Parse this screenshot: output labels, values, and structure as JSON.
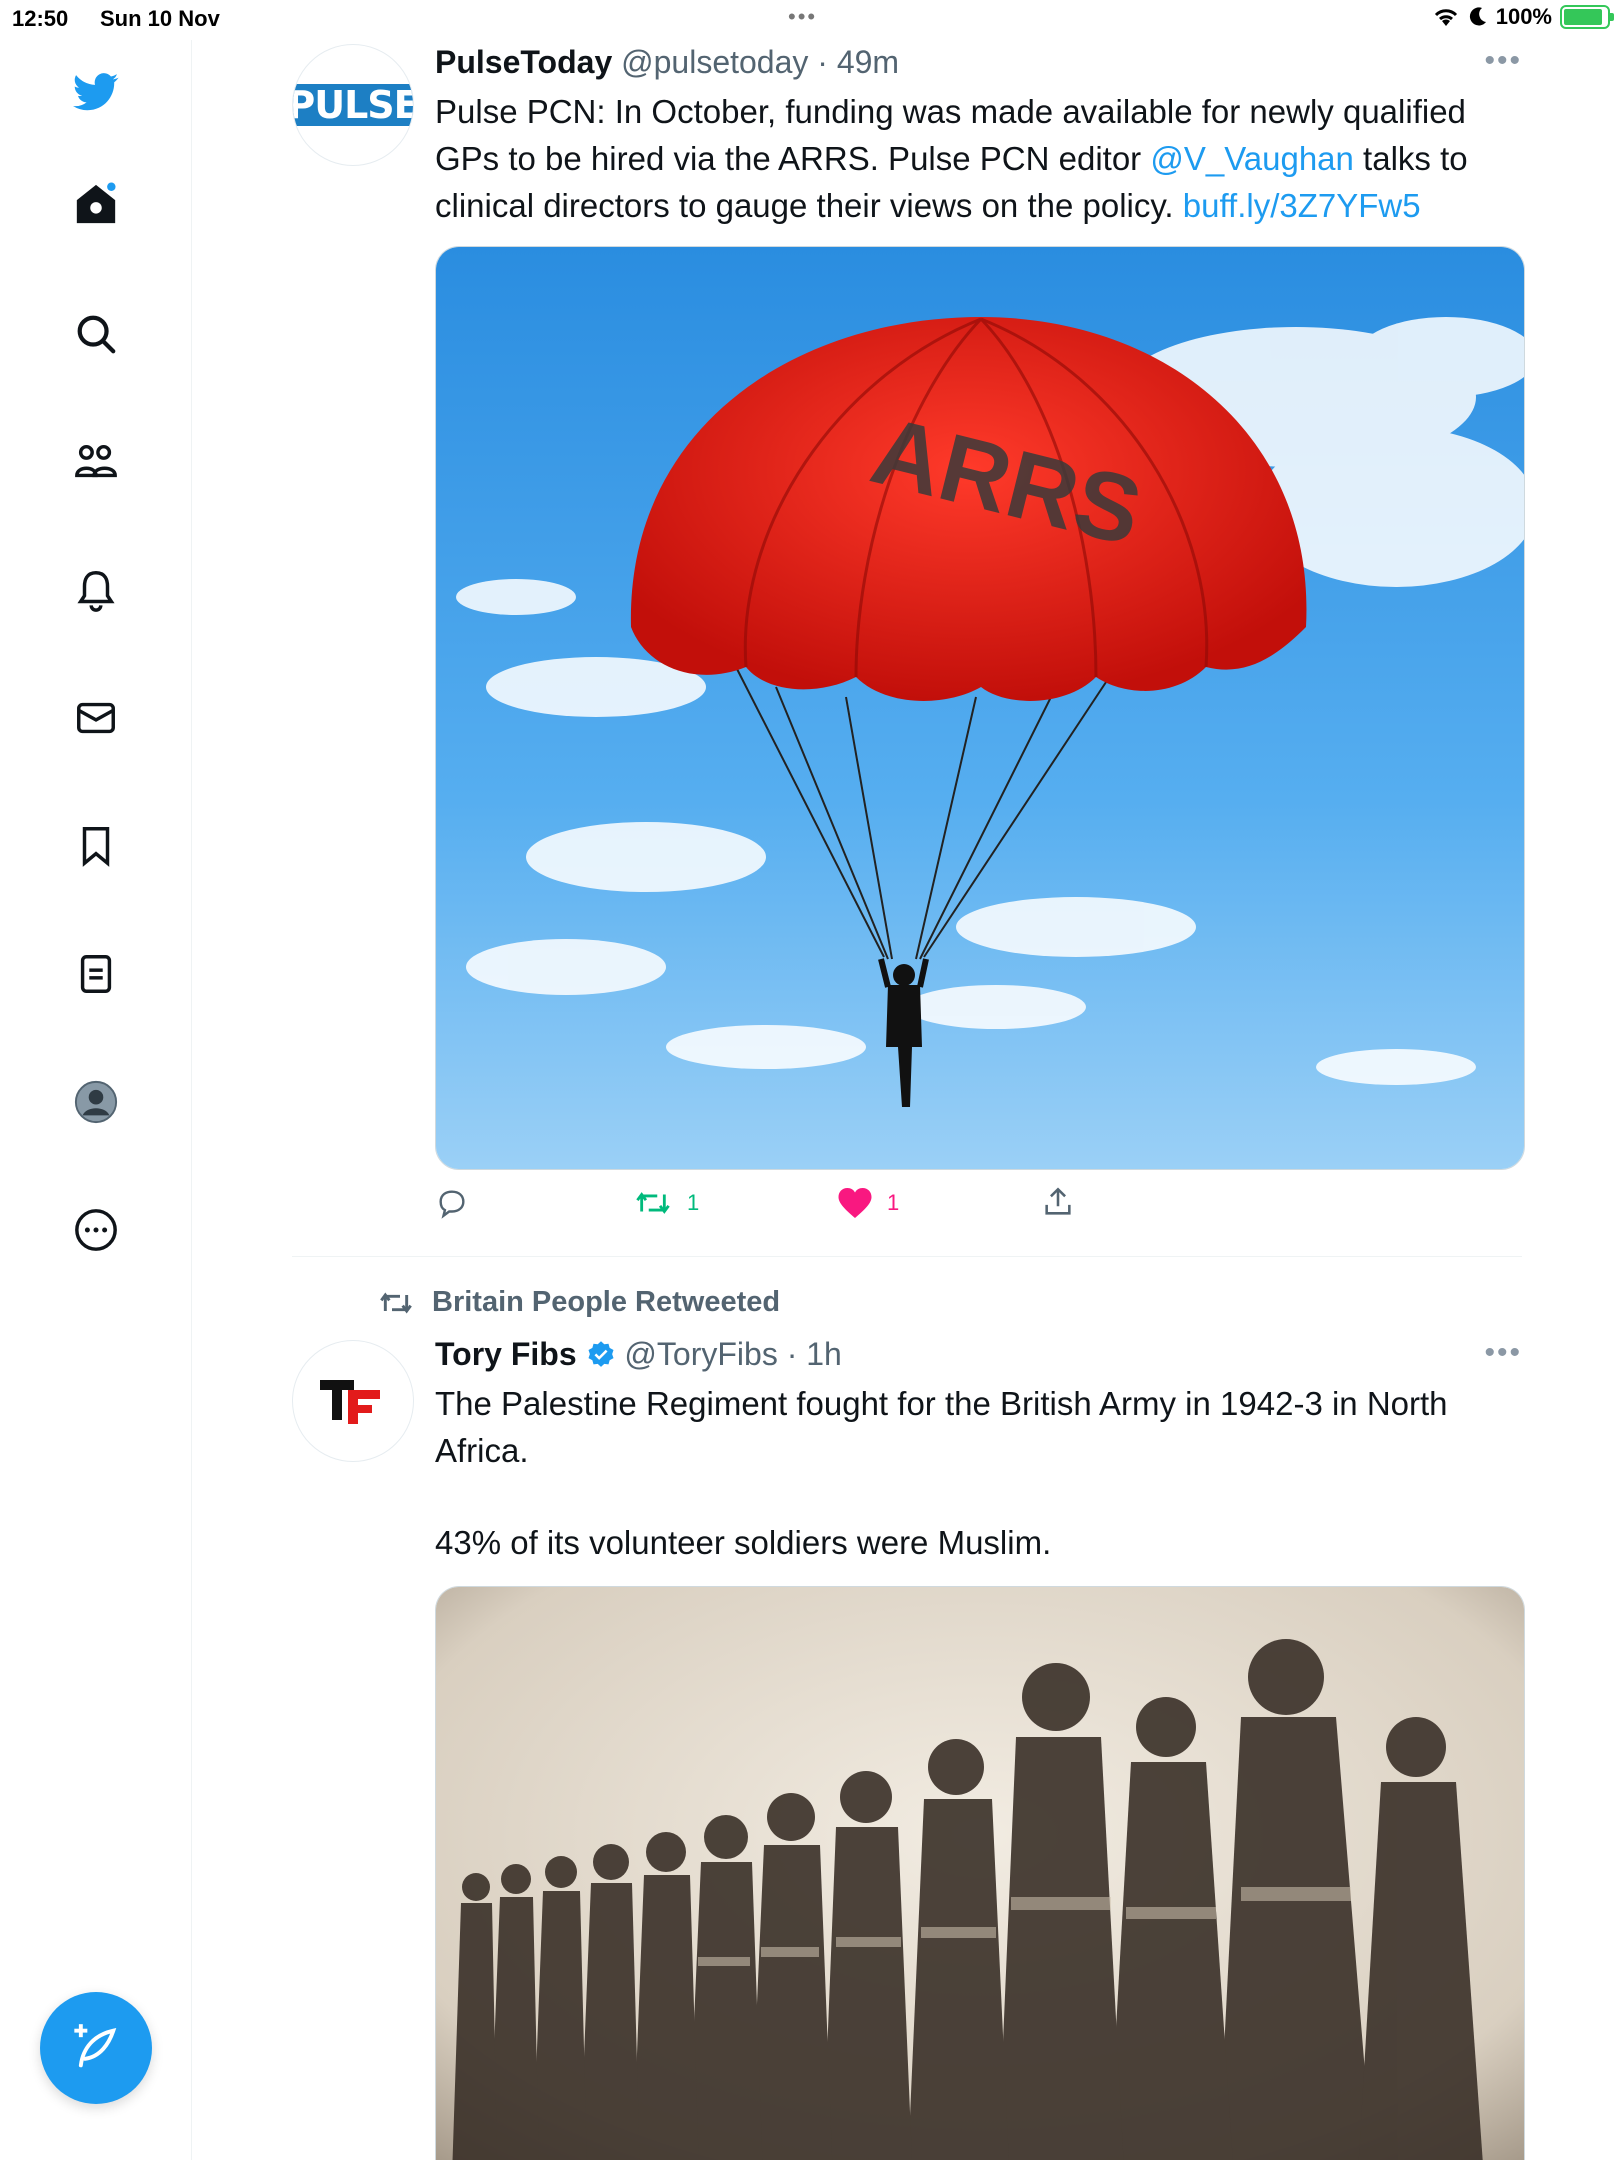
{
  "status_bar": {
    "time": "12:50",
    "date": "Sun 10 Nov",
    "battery": "100%"
  },
  "sidebar": {
    "items": [
      {
        "icon": "twitter-bird-icon"
      },
      {
        "icon": "home-icon"
      },
      {
        "icon": "search-icon"
      },
      {
        "icon": "communities-icon"
      },
      {
        "icon": "notifications-icon"
      },
      {
        "icon": "messages-icon"
      },
      {
        "icon": "bookmarks-icon"
      },
      {
        "icon": "lists-icon"
      },
      {
        "icon": "profile-icon"
      },
      {
        "icon": "more-icon"
      }
    ],
    "compose_icon": "compose-tweet-icon"
  },
  "tweets": [
    {
      "avatar_text": "PULSE",
      "name": "PulseToday",
      "handle": "@pulsetoday",
      "time": "49m",
      "text_before": "Pulse PCN: In October, funding was made available for newly qualified GPs to be hired via the ARRS. Pulse PCN editor ",
      "mention": "@V_Vaughan",
      "text_after": " talks to clinical directors to gauge their views on the policy. ",
      "url": "buff.ly/3Z7YFw5",
      "image_caption": "ARRS",
      "retweets": "1",
      "likes": "1"
    },
    {
      "retweeted_by": "Britain People Retweeted",
      "avatar_text": "TF",
      "name": "Tory Fibs",
      "handle": "@ToryFibs",
      "time": "1h",
      "text_line1": "The Palestine Regiment fought for the British Army in 1942-3 in North Africa.",
      "text_line2": "43% of its volunteer soldiers were Muslim."
    }
  ],
  "colors": {
    "accent": "#1d9bf0",
    "retweet": "#00ba7c",
    "like": "#f91880",
    "secondary_text": "#536471"
  }
}
